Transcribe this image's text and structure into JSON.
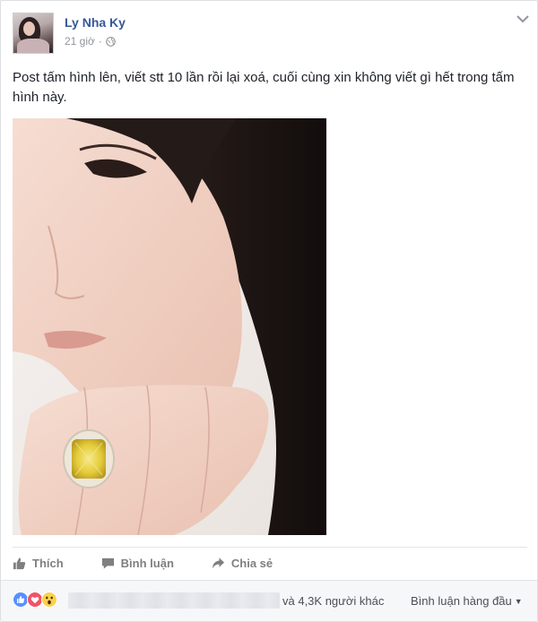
{
  "post": {
    "author": "Ly Nha Ky",
    "time": "21 giờ",
    "separator": "·",
    "text": "Post tấm hình lên, viết stt 10 lần rồi lại xoá, cuối cùng xin không viết gì hết trong tấm hình này.",
    "privacy_icon": "globe-icon",
    "options_icon": "chevron-down-icon"
  },
  "actions": {
    "like_label": "Thích",
    "comment_label": "Bình luận",
    "share_label": "Chia sẻ"
  },
  "reactions": {
    "icons": [
      "like-reaction-icon",
      "love-reaction-icon",
      "wow-reaction-icon"
    ],
    "others_text": "và 4,3K người khác",
    "sort_label": "Bình luận hàng đầu",
    "sort_caret": "▼"
  },
  "colors": {
    "link_blue": "#365899",
    "like_blue": "#5890ff",
    "love_red": "#f25268",
    "wow_yellow": "#fcd04d"
  }
}
